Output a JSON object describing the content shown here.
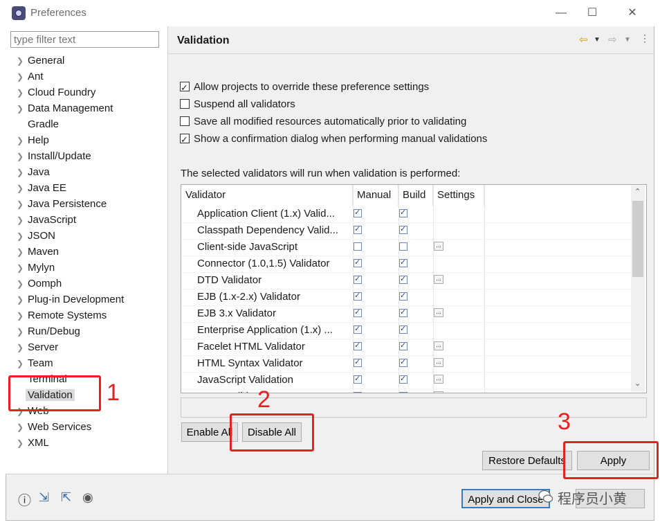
{
  "window": {
    "title": "Preferences",
    "minimize_icon": "minimize-icon",
    "maximize_icon": "maximize-icon",
    "close_icon": "close-icon"
  },
  "filter": {
    "placeholder": "type filter text"
  },
  "tree": [
    {
      "label": "General",
      "expandable": true
    },
    {
      "label": "Ant",
      "expandable": true
    },
    {
      "label": "Cloud Foundry",
      "expandable": true
    },
    {
      "label": "Data Management",
      "expandable": true
    },
    {
      "label": "Gradle",
      "expandable": false
    },
    {
      "label": "Help",
      "expandable": true
    },
    {
      "label": "Install/Update",
      "expandable": true
    },
    {
      "label": "Java",
      "expandable": true
    },
    {
      "label": "Java EE",
      "expandable": true
    },
    {
      "label": "Java Persistence",
      "expandable": true
    },
    {
      "label": "JavaScript",
      "expandable": true
    },
    {
      "label": "JSON",
      "expandable": true
    },
    {
      "label": "Maven",
      "expandable": true
    },
    {
      "label": "Mylyn",
      "expandable": true
    },
    {
      "label": "Oomph",
      "expandable": true
    },
    {
      "label": "Plug-in Development",
      "expandable": true
    },
    {
      "label": "Remote Systems",
      "expandable": true
    },
    {
      "label": "Run/Debug",
      "expandable": true
    },
    {
      "label": "Server",
      "expandable": true
    },
    {
      "label": "Team",
      "expandable": true
    },
    {
      "label": "Terminal",
      "expandable": false
    },
    {
      "label": "Validation",
      "expandable": false,
      "selected": true
    },
    {
      "label": "Web",
      "expandable": true
    },
    {
      "label": "Web Services",
      "expandable": true
    },
    {
      "label": "XML",
      "expandable": true
    }
  ],
  "page": {
    "title": "Validation"
  },
  "options": [
    {
      "label": "Allow projects to override these preference settings",
      "checked": true
    },
    {
      "label": "Suspend all validators",
      "checked": false
    },
    {
      "label": "Save all modified resources automatically prior to validating",
      "checked": false
    },
    {
      "label": "Show a confirmation dialog when performing manual validations",
      "checked": true
    }
  ],
  "validators_label": "The selected validators will run when validation is performed:",
  "table": {
    "columns": [
      "Validator",
      "Manual",
      "Build",
      "Settings"
    ],
    "rows": [
      {
        "name": "Application Client (1.x) Valid...",
        "manual": true,
        "build": true,
        "settings": false
      },
      {
        "name": "Classpath Dependency Valid...",
        "manual": true,
        "build": true,
        "settings": false
      },
      {
        "name": "Client-side JavaScript",
        "manual": false,
        "build": false,
        "settings": true
      },
      {
        "name": "Connector (1.0,1.5) Validator",
        "manual": true,
        "build": true,
        "settings": false
      },
      {
        "name": "DTD Validator",
        "manual": true,
        "build": true,
        "settings": true
      },
      {
        "name": "EJB (1.x-2.x) Validator",
        "manual": true,
        "build": true,
        "settings": false
      },
      {
        "name": "EJB 3.x Validator",
        "manual": true,
        "build": true,
        "settings": true
      },
      {
        "name": "Enterprise Application (1.x) ...",
        "manual": true,
        "build": true,
        "settings": false
      },
      {
        "name": "Facelet HTML Validator",
        "manual": true,
        "build": true,
        "settings": true
      },
      {
        "name": "HTML Syntax Validator",
        "manual": true,
        "build": true,
        "settings": true
      },
      {
        "name": "JavaScript Validation",
        "manual": true,
        "build": true,
        "settings": true
      },
      {
        "name": "JAXB Validator",
        "manual": true,
        "build": true,
        "settings": true
      }
    ]
  },
  "buttons": {
    "enable_all": "Enable All",
    "disable_all": "Disable All",
    "restore_defaults": "Restore Defaults",
    "apply": "Apply",
    "apply_and_close": "Apply and Close"
  },
  "annotations": {
    "one": "1",
    "two": "2",
    "three": "3"
  },
  "watermark": "程序员小黄",
  "colors": {
    "annotation_red": "#e82020"
  }
}
